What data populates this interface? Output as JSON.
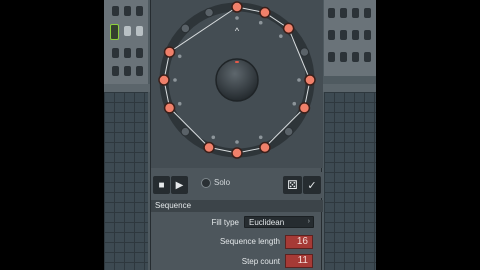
{
  "toolbar": {
    "solo_label": "Solo",
    "stop_glyph": "■",
    "play_glyph": "▶",
    "dice_glyph": "⚄",
    "check_glyph": "✓"
  },
  "sequence": {
    "section_title": "Sequence",
    "fill_type_label": "Fill type",
    "fill_type_value": "Euclidean",
    "sequence_length_label": "Sequence length",
    "sequence_length_value": "16",
    "step_count_label": "Step count",
    "step_count_value": "11"
  },
  "wheel": {
    "steps_total": 16,
    "active_steps": [
      0,
      1,
      2,
      4,
      5,
      7,
      8,
      9,
      11,
      12,
      13
    ],
    "accent_color": "#f0806a",
    "inactive_color": "#5a6268",
    "polygon_color": "#d8dcde",
    "indicator_glyph": "^"
  },
  "colors": {
    "panel": "#4d565c",
    "field_red": "#a63a36",
    "grid_green": "#8ccf3c"
  }
}
